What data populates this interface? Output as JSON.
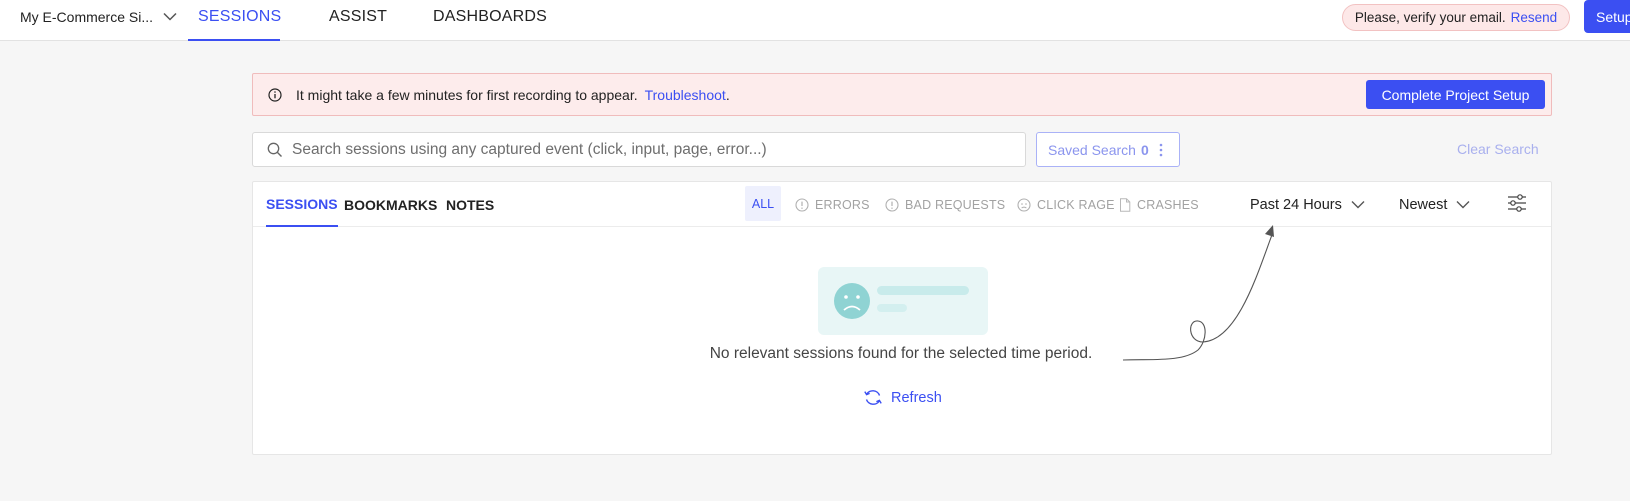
{
  "topbar": {
    "site_name": "My E-Commerce Si...",
    "tabs": [
      {
        "label": "SESSIONS",
        "active": true
      },
      {
        "label": "ASSIST",
        "active": false
      },
      {
        "label": "DASHBOARDS",
        "active": false
      }
    ],
    "verify": {
      "text": "Please, verify your email.",
      "link": "Resend"
    },
    "setup_label": "Setup"
  },
  "banner": {
    "message": "It might take a few minutes for first recording to appear.",
    "link": "Troubleshoot",
    "link_suffix": ".",
    "button": "Complete Project Setup"
  },
  "search": {
    "placeholder": "Search sessions using any captured event (click, input, page, error...)",
    "value": "",
    "saved_label": "Saved Search",
    "saved_count": "0",
    "clear_label": "Clear Search"
  },
  "panel": {
    "tabs": [
      {
        "label": "SESSIONS",
        "active": true
      },
      {
        "label": "BOOKMARKS",
        "active": false
      },
      {
        "label": "NOTES",
        "active": false
      }
    ],
    "filters": [
      {
        "label": "ALL",
        "active": true
      },
      {
        "label": "ERRORS",
        "icon": "alert-circle-icon"
      },
      {
        "label": "BAD REQUESTS",
        "icon": "alert-circle-icon"
      },
      {
        "label": "CLICK RAGE",
        "icon": "angry-face-icon"
      },
      {
        "label": "CRASHES",
        "icon": "file-icon"
      }
    ],
    "time_range": "Past 24 Hours",
    "sort": "Newest",
    "empty_message": "No relevant sessions found for the selected time period.",
    "refresh_label": "Refresh"
  },
  "colors": {
    "accent": "#3b4ff2",
    "banner_bg": "#fdecec",
    "empty_illustration": "#e8f6f6",
    "sad_face": "#8fd3d3"
  }
}
